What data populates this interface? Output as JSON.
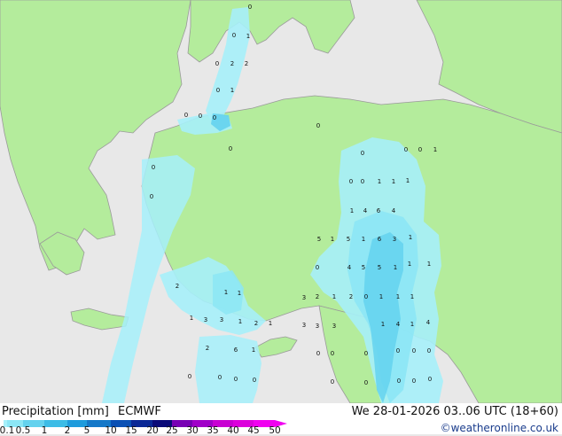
{
  "legend": {
    "title": "Precipitation [mm]",
    "model": "ECMWF",
    "valid": "We 28-01-2026 03..06 UTC (18+60)",
    "copyright": "©weatheronline.co.uk",
    "ticks": [
      "0.1",
      "0.5",
      "1",
      "2",
      "5",
      "10",
      "15",
      "20",
      "25",
      "30",
      "35",
      "40",
      "45",
      "50"
    ],
    "colors": [
      "#a6f0fa",
      "#8ce6f5",
      "#64d2ee",
      "#3cbce6",
      "#1e9bdc",
      "#1478c8",
      "#0a50b4",
      "#0a2896",
      "#0a0a78",
      "#7800b4",
      "#a000c8",
      "#c800d2",
      "#dc00dc",
      "#f000f0"
    ]
  },
  "map": {
    "land_color": "#b4ec9c",
    "sea_color": "#e8e8e8",
    "precip_light": "#a6f0fa",
    "precip_medium": "#8ce6f5",
    "precip_heavy": "#64d2ee",
    "labels": [
      "0",
      "1",
      "2",
      "0",
      "2",
      "0",
      "1",
      "0",
      "0",
      "0",
      "0",
      "0",
      "0",
      "0",
      "0",
      "0",
      "0",
      "0",
      "1",
      "0",
      "0",
      "1",
      "1",
      "1",
      "1",
      "4",
      "6",
      "4",
      "5",
      "1",
      "5",
      "1",
      "6",
      "3",
      "1",
      "0",
      "4",
      "5",
      "5",
      "1",
      "1",
      "1",
      "2",
      "1",
      "1",
      "3",
      "2",
      "1",
      "2",
      "0",
      "1",
      "1",
      "1",
      "1",
      "3",
      "3",
      "1",
      "2",
      "1",
      "3",
      "3",
      "3",
      "1",
      "4",
      "1",
      "4",
      "2",
      "6",
      "1",
      "0",
      "0",
      "0",
      "0",
      "0",
      "0",
      "0",
      "0",
      "0",
      "0",
      "0",
      "0",
      "0",
      "0",
      "0"
    ]
  }
}
